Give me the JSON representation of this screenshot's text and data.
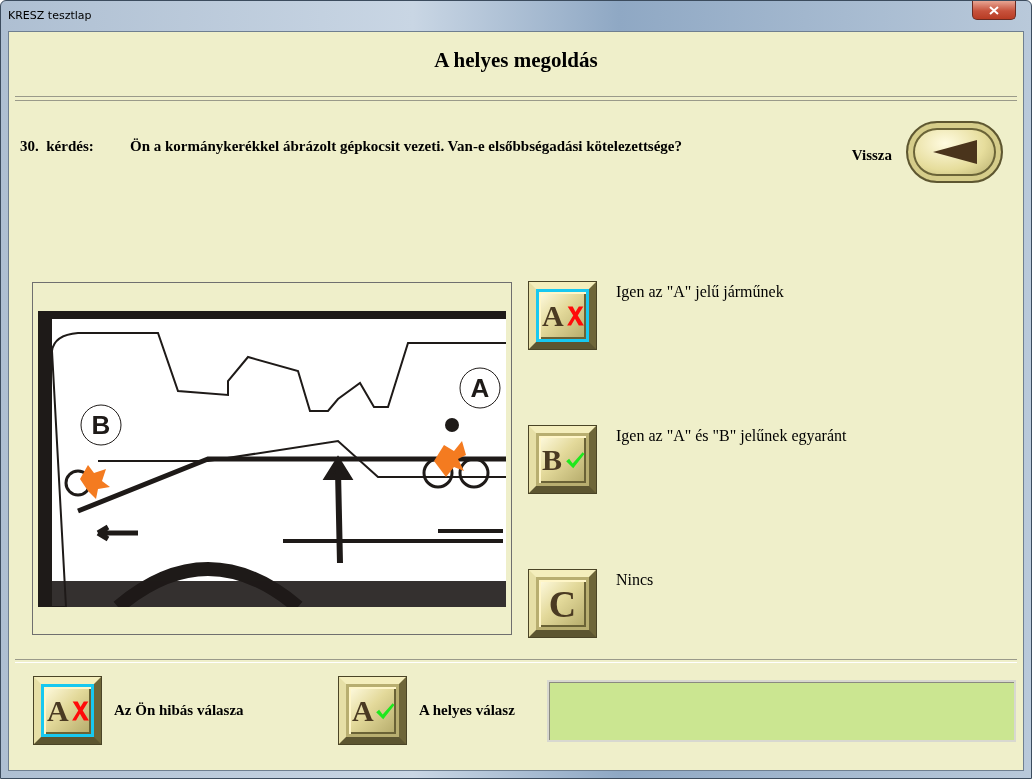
{
  "window": {
    "title": "KRESZ tesztlap"
  },
  "heading": "A helyes megoldás",
  "question": {
    "number": "30.  kérdés:",
    "text": "Ön a kormánykerékkel ábrázolt gépkocsit vezeti. Van-e elsőbbségadási kötelezettsége?"
  },
  "back": {
    "label": "Vissza"
  },
  "illustration": {
    "labels": [
      "B",
      "A"
    ]
  },
  "answers": [
    {
      "letter": "A",
      "text": "Igen az \"A\" jelű járműnek",
      "crossed": true,
      "ticked": false,
      "selected": true
    },
    {
      "letter": "B",
      "text": "Igen az \"A\" és \"B\" jelűnek egyaránt",
      "crossed": false,
      "ticked": true,
      "selected": false
    },
    {
      "letter": "C",
      "text": "Nincs",
      "crossed": false,
      "ticked": false,
      "selected": false
    }
  ],
  "legend": [
    {
      "letter": "A",
      "crossed": true,
      "ticked": false,
      "selected": true,
      "label": "Az Ön hibás válasza"
    },
    {
      "letter": "A",
      "crossed": false,
      "ticked": true,
      "selected": false,
      "label": "A helyes válasz"
    }
  ]
}
